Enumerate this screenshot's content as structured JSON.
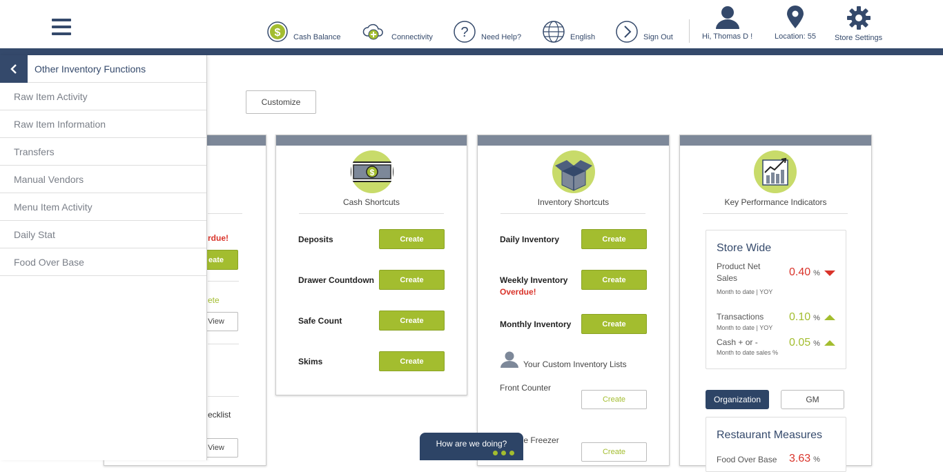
{
  "header": {
    "nav": {
      "cash_balance": "Cash Balance",
      "connectivity": "Connectivity",
      "need_help": "Need Help?",
      "language": "English",
      "sign_out": "Sign Out",
      "greeting": "Hi,  Thomas D !",
      "location": "Location: 55",
      "store_settings": "Store Settings"
    }
  },
  "customize_label": "Customize",
  "sidebar": {
    "title": "Other Inventory Functions",
    "items": [
      "Raw Item Activity",
      "Raw Item Information",
      "Transfers",
      "Manual Vendors",
      "Menu Item Activity",
      "Daily Stat",
      "Food Over Base"
    ]
  },
  "partial_card": {
    "overdue": "rdue!",
    "create": "eate",
    "complete": "ete",
    "view1": "View",
    "checklist": "ecklist",
    "view2": "View"
  },
  "cash_card": {
    "title": "Cash Shortcuts",
    "rows": [
      {
        "label": "Deposits",
        "button": "Create"
      },
      {
        "label": "Drawer Countdown",
        "button": "Create"
      },
      {
        "label": "Safe Count",
        "button": "Create"
      },
      {
        "label": "Skims",
        "button": "Create"
      }
    ]
  },
  "inventory_card": {
    "title": "Inventory Shortcuts",
    "rows": [
      {
        "label": "Daily Inventory",
        "sub": "",
        "button": "Create"
      },
      {
        "label": "Weekly Inventory",
        "sub": "Overdue!",
        "button": "Create"
      },
      {
        "label": "Monthly Inventory",
        "sub": "",
        "button": "Create"
      }
    ],
    "custom_lists_label": "Your Custom Inventory Lists",
    "custom_rows": [
      {
        "label": "Front Counter",
        "button": "Create"
      },
      {
        "label": "ide Freezer",
        "button": "Create"
      }
    ]
  },
  "kpi_card": {
    "title": "Key Performance Indicators",
    "store_wide": {
      "title": "Store Wide",
      "metrics": [
        {
          "name": "Product Net Sales",
          "sub": "Month to date | YOY",
          "value": "0.40",
          "unit": "%",
          "trend": "down"
        },
        {
          "name": "Transactions",
          "sub": "Month to date | YOY",
          "value": "0.10",
          "unit": "%",
          "trend": "up"
        },
        {
          "name": "Cash + or -",
          "sub": "Month to date sales %",
          "value": "0.05",
          "unit": "%",
          "trend": "up"
        }
      ]
    },
    "toggle": {
      "org": "Organization",
      "gm": "GM"
    },
    "restaurant": {
      "title": "Restaurant Measures",
      "metric_name": "Food Over Base",
      "metric_value": "3.63",
      "metric_unit": "%"
    }
  },
  "feedback_label": "How are we doing?",
  "colors": {
    "navy": "#34496b",
    "green": "#a3bd2f",
    "red": "#d9332a",
    "card_cap": "#7d8899"
  }
}
